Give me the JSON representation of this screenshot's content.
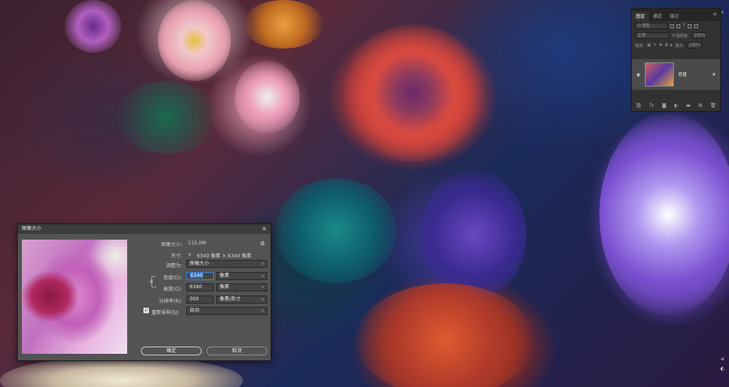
{
  "layers_panel": {
    "tabs": [
      "图层",
      "通道",
      "路径"
    ],
    "menu_icon": "menu-icon",
    "filter_placeholder": "Q 类型",
    "blend_mode": "正常",
    "opacity_label": "不透明度:",
    "opacity_value": "100%",
    "lock_label": "锁定:",
    "fill_label": "填充:",
    "fill_value": "100%",
    "layer_name": "背景",
    "bottom_icons": [
      "link-icon",
      "fx-icon",
      "mask-icon",
      "adjustment-icon",
      "folder-icon",
      "new-layer-icon",
      "trash-icon"
    ]
  },
  "dialog": {
    "title": "图像大小",
    "image_size_label": "图像大小:",
    "image_size_value": "115.0M",
    "dimensions_label": "尺寸:",
    "dimensions_value": "6340 像素  ×  6340 像素",
    "fit_to_label": "调整为:",
    "fit_to_value": "原稿大小",
    "width_label": "宽度(D):",
    "width_value": "6340",
    "width_unit": "像素",
    "height_label": "高度(G):",
    "height_value": "6340",
    "height_unit": "像素",
    "resolution_label": "分辨率(R):",
    "resolution_value": "300",
    "resolution_unit": "像素/英寸",
    "resample_label": "重新采样(S):",
    "resample_checked": true,
    "resample_value": "自动",
    "ok_label": "确定",
    "cancel_label": "取消"
  }
}
